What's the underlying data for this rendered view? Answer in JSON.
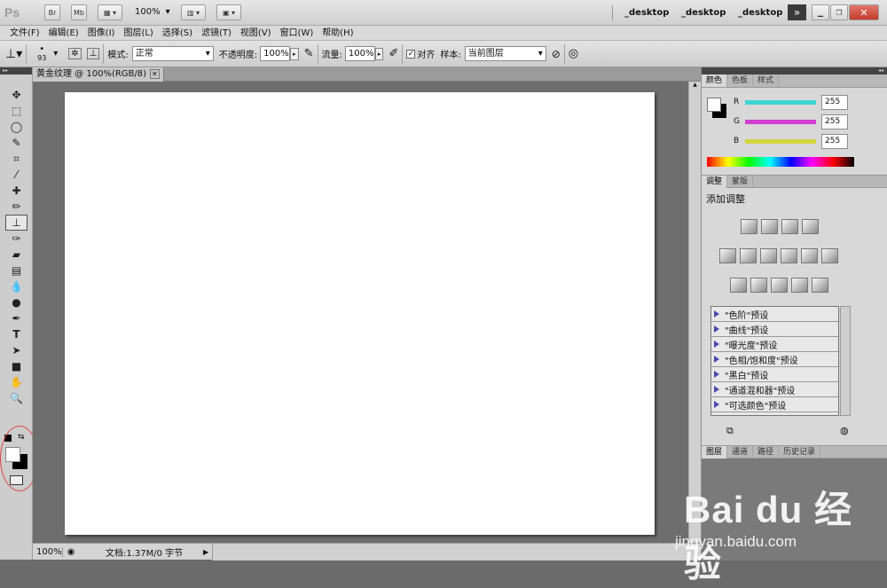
{
  "app": {
    "logo": "Ps",
    "bridge": "Br",
    "mini_bridge": "Mb",
    "zoom": "100%",
    "workspaces": [
      "_desktop",
      "_desktop",
      "_desktop"
    ],
    "more": "»"
  },
  "menu": [
    "文件(F)",
    "编辑(E)",
    "图像(I)",
    "图层(L)",
    "选择(S)",
    "滤镜(T)",
    "视图(V)",
    "窗口(W)",
    "帮助(H)"
  ],
  "options": {
    "brush_size": "93",
    "mode_label": "模式:",
    "mode_value": "正常",
    "opacity_label": "不透明度:",
    "opacity_value": "100%",
    "flow_label": "流量:",
    "flow_value": "100%",
    "aligned_label": "对齐",
    "sample_label": "样本:",
    "sample_value": "当前图层"
  },
  "document": {
    "tab_title": "黄金纹理 @ 100%(RGB/8)",
    "close": "✕",
    "status_zoom": "100%",
    "status_info": "文档:1.37M/0 字节"
  },
  "color_panel": {
    "tabs": [
      "颜色",
      "色板",
      "样式"
    ],
    "channels": [
      {
        "label": "R",
        "value": "255",
        "color": "#3fd4d4"
      },
      {
        "label": "G",
        "value": "255",
        "color": "#d040d0"
      },
      {
        "label": "B",
        "value": "255",
        "color": "#d4d43f"
      }
    ]
  },
  "adjust_panel": {
    "tabs": [
      "调整",
      "蒙版"
    ],
    "title": "添加调整",
    "presets": [
      "\"色阶\"预设",
      "\"曲线\"预设",
      "\"曝光度\"预设",
      "\"色相/饱和度\"预设",
      "\"黑白\"预设",
      "\"通道混和器\"预设",
      "\"可选颜色\"预设"
    ]
  },
  "layers_panel": {
    "tabs": [
      "图层",
      "通道",
      "路径",
      "历史记录"
    ]
  },
  "watermark": {
    "logo": "Bai du 经验",
    "url": "jingyan.baidu.com"
  }
}
